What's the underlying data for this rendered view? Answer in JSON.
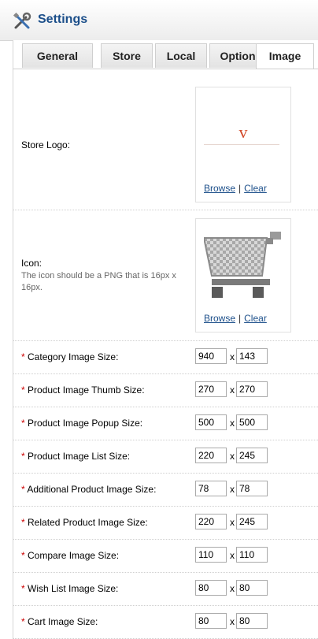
{
  "header": {
    "title": "Settings",
    "icon": "tools-icon"
  },
  "tabs": [
    {
      "label": "General"
    },
    {
      "label": "Store"
    },
    {
      "label": "Local"
    },
    {
      "label": "Option"
    },
    {
      "label": "Image",
      "active": true
    }
  ],
  "store_logo": {
    "label": "Store Logo:",
    "logo_text": "V",
    "browse": "Browse",
    "separator": "|",
    "clear": "Clear"
  },
  "icon_setting": {
    "label": "Icon:",
    "help": "The icon should be a PNG that is 16px x 16px.",
    "browse": "Browse",
    "separator": "|",
    "clear": "Clear"
  },
  "required_mark": "*",
  "size_separator": "x",
  "sizes": [
    {
      "label": "Category Image Size:",
      "width": "940",
      "height": "143"
    },
    {
      "label": "Product Image Thumb Size:",
      "width": "270",
      "height": "270"
    },
    {
      "label": "Product Image Popup Size:",
      "width": "500",
      "height": "500"
    },
    {
      "label": "Product Image List Size:",
      "width": "220",
      "height": "245"
    },
    {
      "label": "Additional Product Image Size:",
      "width": "78",
      "height": "78"
    },
    {
      "label": "Related Product Image Size:",
      "width": "220",
      "height": "245"
    },
    {
      "label": "Compare Image Size:",
      "width": "110",
      "height": "110"
    },
    {
      "label": "Wish List Image Size:",
      "width": "80",
      "height": "80"
    },
    {
      "label": "Cart Image Size:",
      "width": "80",
      "height": "80"
    }
  ],
  "colors": {
    "title": "#1c4f8a",
    "required": "#cc0000",
    "link": "#1c4f8a",
    "logo": "#d24a2a"
  }
}
